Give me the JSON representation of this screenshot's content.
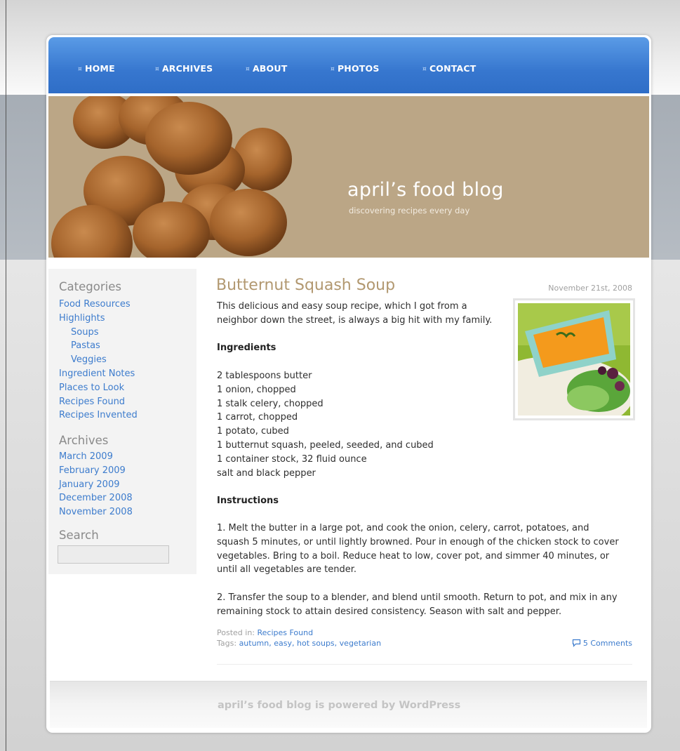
{
  "nav": {
    "items": [
      "HOME",
      "ARCHIVES",
      "ABOUT",
      "PHOTOS",
      "CONTACT"
    ]
  },
  "header": {
    "title": "april’s food blog",
    "subtitle": "discovering recipes every day"
  },
  "sidebar": {
    "categories_heading": "Categories",
    "categories": [
      {
        "label": "Food Resources",
        "indent": false
      },
      {
        "label": "Highlights",
        "indent": false
      },
      {
        "label": "Soups",
        "indent": true
      },
      {
        "label": "Pastas",
        "indent": true
      },
      {
        "label": "Veggies",
        "indent": true
      },
      {
        "label": "Ingredient Notes",
        "indent": false
      },
      {
        "label": "Places to Look",
        "indent": false
      },
      {
        "label": "Recipes Found",
        "indent": false
      },
      {
        "label": "Recipes Invented",
        "indent": false
      }
    ],
    "archives_heading": "Archives",
    "archives": [
      "March 2009",
      "February 2009",
      "January 2009",
      "December 2008",
      "November 2008"
    ],
    "search_heading": "Search",
    "search_value": ""
  },
  "post": {
    "title": "Butternut Squash Soup",
    "date": "November 21st, 2008",
    "intro_line1": "This delicious and easy soup recipe, which I got from a",
    "intro_line2": "neighbor down the street, is always a big hit with my family.",
    "ingredients_heading": "Ingredients",
    "ingredients": [
      "2 tablespoons butter",
      "1 onion, chopped",
      "1 stalk celery, chopped",
      "1 carrot, chopped",
      "1 potato, cubed",
      "1 butternut squash, peeled, seeded, and cubed",
      "1 container stock, 32 fluid ounce",
      "salt and black pepper"
    ],
    "instructions_heading": "Instructions",
    "step1_lines": [
      "1. Melt the butter in a large pot, and cook the onion, celery, carrot, potatoes, and",
      "squash 5 minutes, or until lightly browned. Pour in enough of the chicken stock to cover",
      "vegetables. Bring to a boil. Reduce heat to low, cover pot, and simmer 40 minutes, or",
      "until all vegetables are tender."
    ],
    "step2_lines": [
      "2. Transfer the soup to a blender, and blend until smooth. Return to pot, and mix in any",
      "remaining stock to attain desired consistency. Season with salt and pepper."
    ],
    "posted_in_label": "Posted in:",
    "posted_in_value": "Recipes Found",
    "tags_label": "Tags:",
    "tags": [
      "autumn",
      "easy",
      "hot soups",
      "vegetarian"
    ],
    "comments": "5 Comments"
  },
  "footer": {
    "text": "april’s food blog is powered by WordPress"
  },
  "colors": {
    "nav_blue": "#3777cf",
    "header_tan": "#bba686",
    "title_tan": "#b29870",
    "link_blue": "#3d7ccd"
  },
  "icons": {
    "nav_bullet": "nav-bullet-icon",
    "comment": "speech-bubble-icon"
  }
}
